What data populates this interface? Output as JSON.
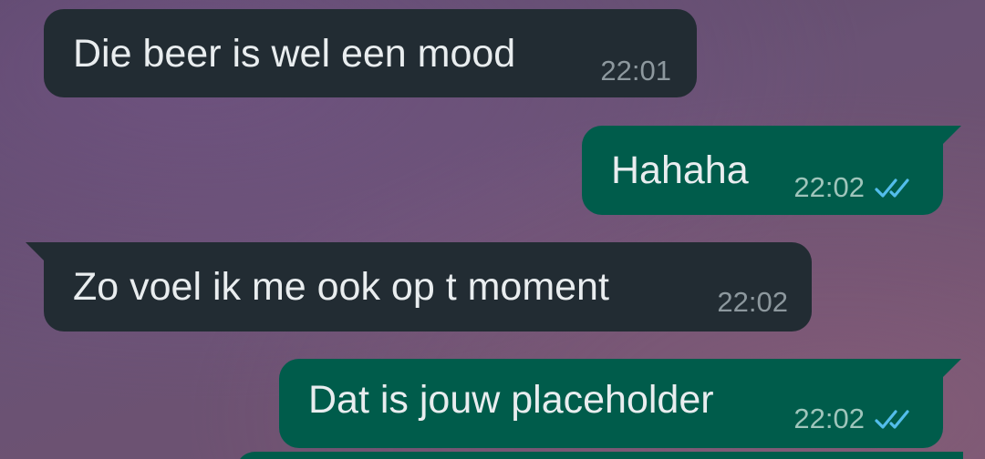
{
  "conversation": {
    "messages": [
      {
        "direction": "incoming",
        "text": "Die beer is wel een mood",
        "time": "22:01"
      },
      {
        "direction": "outgoing",
        "text": "Hahaha",
        "time": "22:02",
        "status": "read"
      },
      {
        "direction": "incoming",
        "text": "Zo voel ik me ook op t moment",
        "time": "22:02"
      },
      {
        "direction": "outgoing",
        "text": "Dat is jouw placeholder",
        "time": "22:02",
        "status": "read"
      }
    ]
  },
  "colors": {
    "incoming_bubble": "#222c33",
    "outgoing_bubble": "#005c4b",
    "read_ticks": "#53bdeb"
  },
  "icons": {
    "read_receipt": "double-check-icon"
  }
}
